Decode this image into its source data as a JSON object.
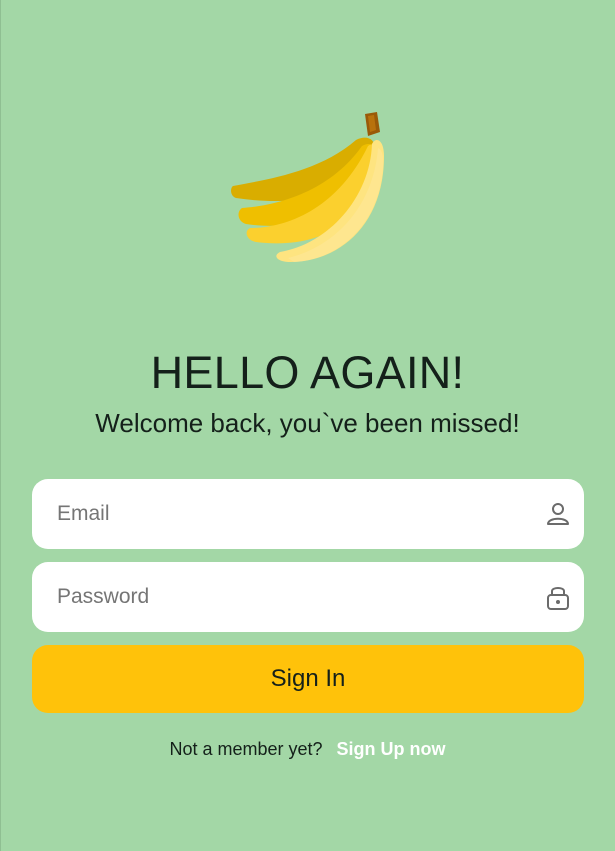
{
  "logo": {
    "icon": "banana-bunch-icon",
    "colors": [
      "#fee480",
      "#fbd02e",
      "#f2c400",
      "#d9ad00",
      "#9a5a08"
    ]
  },
  "header": {
    "title": "HELLO AGAIN!",
    "subtitle": "Welcome back, you`ve been missed!"
  },
  "form": {
    "email": {
      "placeholder": "Email",
      "value": "",
      "icon": "user-icon"
    },
    "password": {
      "placeholder": "Password",
      "value": "",
      "icon": "lock-icon"
    },
    "submit_label": "Sign In"
  },
  "footer": {
    "prompt": "Not a member yet?",
    "link": "Sign Up now"
  },
  "colors": {
    "background": "#a3d7a6",
    "button": "#ffc20a",
    "field_background": "#ffffff",
    "text": "#14201a",
    "link": "#ffffff"
  }
}
